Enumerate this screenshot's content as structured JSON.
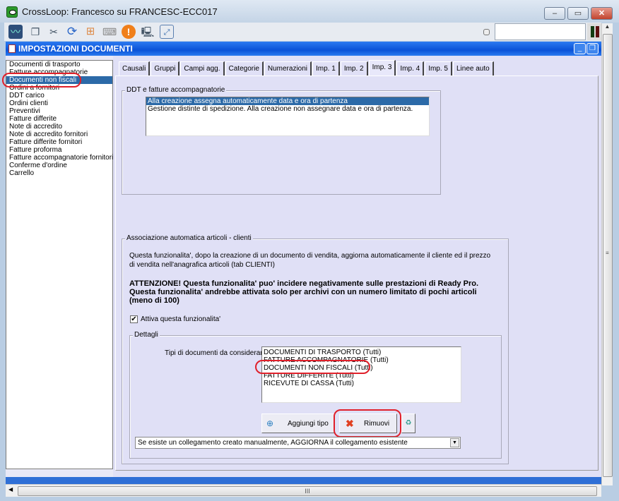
{
  "window": {
    "title": "CrossLoop: Francesco su FRANCESC-ECC017",
    "min": "–",
    "max": "▭",
    "close": "✕"
  },
  "toolbar": {
    "icons": [
      "monitor-icon",
      "windows-icon",
      "tools-icon",
      "refresh-icon",
      "windows-logo-icon",
      "keyboard-icon",
      "warning-icon",
      "disconnect-icon",
      "fullscreen-icon"
    ],
    "input_value": ""
  },
  "inner": {
    "title": "IMPOSTAZIONI DOCUMENTI"
  },
  "doc_list": [
    "Documenti di trasporto",
    "Fatture accompagnatorie",
    "Documenti non fiscali",
    "Ordini a fornitori",
    "DDT carico",
    "Ordini clienti",
    "Preventivi",
    "Fatture differite",
    "Note di accredito",
    "Note di accredito fornitori",
    "Fatture differite fornitori",
    "Fatture proforma",
    "Fatture accompagnatorie fornitori",
    "Conferme d'ordine",
    "Carrello"
  ],
  "doc_list_selected": 2,
  "tabs": [
    "Causali",
    "Gruppi",
    "Campi agg.",
    "Categorie",
    "Numerazioni",
    "Imp. 1",
    "Imp. 2",
    "Imp. 3",
    "Imp. 4",
    "Imp. 5",
    "Linee auto"
  ],
  "active_tab": 7,
  "ddt": {
    "label": "DDT e fatture accompagnatorie",
    "options": [
      "Alla creazione assegna automaticamente data e ora di partenza",
      "Gestione distinte di spedizione. Alla creazione non assegnare data e ora di partenza."
    ],
    "selected": 0
  },
  "assoc": {
    "label": "Associazione automatica articoli - clienti",
    "desc1": "Questa funzionalita', dopo la creazione di un documento di vendita, aggiorna automaticamente il cliente ed il prezzo",
    "desc2": "di vendita nell'anagrafica articoli (tab CLIENTI)",
    "warn1": "ATTENZIONE! Questa funzionalita' puo' incidere negativamente sulle prestazioni di Ready Pro.",
    "warn2": "Questa funzionalita' andrebbe attivata solo per archivi con un numero limitato di pochi articoli",
    "warn3": "(meno di 100)",
    "checkbox_label": "Attiva questa funzionalita'",
    "checked": true,
    "details_label": "Dettagli",
    "types_label": "Tipi di documenti da considerare:",
    "types": [
      "DOCUMENTI DI TRASPORTO (Tutti)",
      "FATTURE ACCOMPAGNATORIE (Tutti)",
      "DOCUMENTI NON FISCALI (Tutti)",
      "FATTURE DIFFERITE (Tutti)",
      "RICEVUTE DI CASSA (Tutti)"
    ],
    "add_label": "Aggiungi tipo",
    "remove_label": "Rimuovi",
    "combo_value": "Se esiste un collegamento creato manualmente, AGGIORNA il collegamento esistente"
  },
  "hscroll_grip": "III"
}
